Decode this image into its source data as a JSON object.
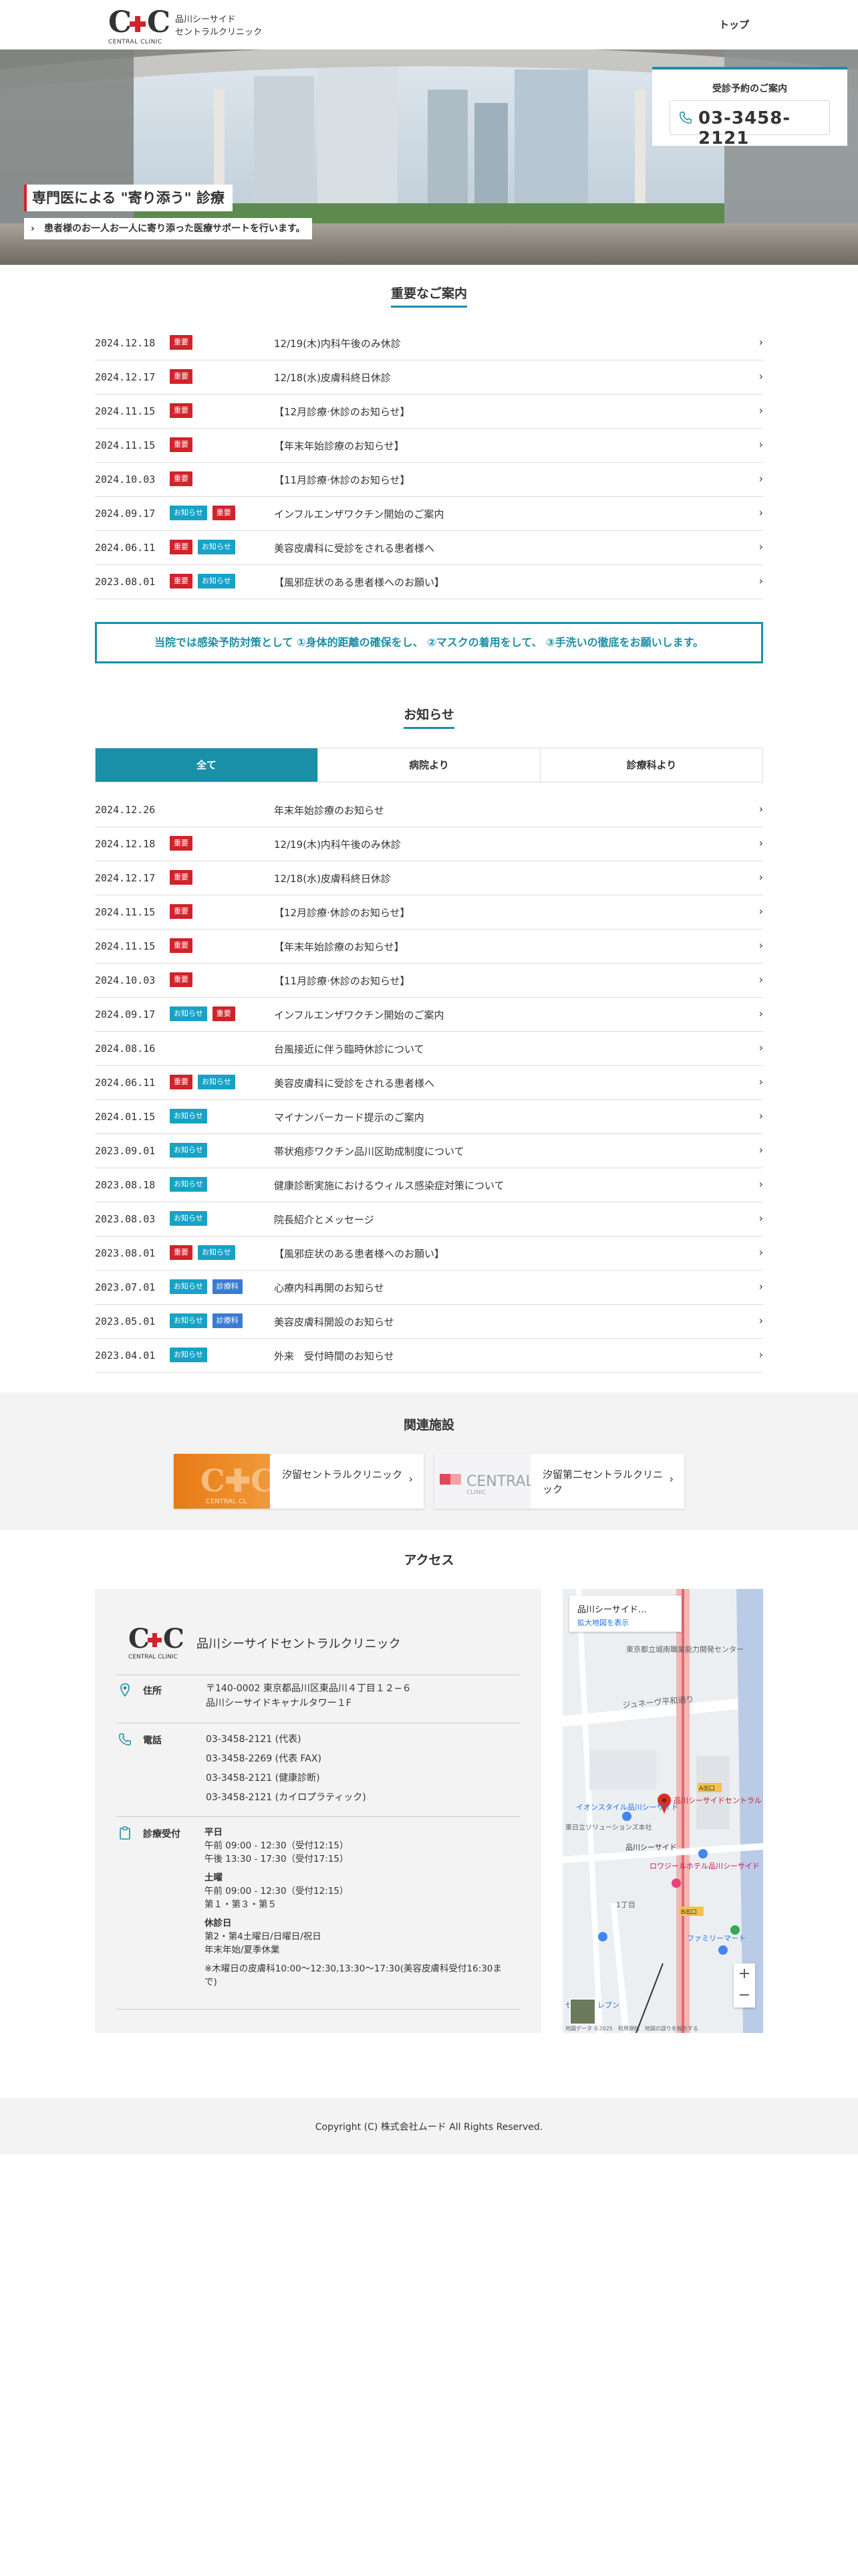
{
  "header": {
    "logo_text": "C✚C",
    "logo_sub": "CENTRAL CLINIC",
    "clinic_name": "品川シーサイド\nセントラルクリニック",
    "nav_top": "トップ"
  },
  "hero": {
    "reserve_title": "受診予約のご案内",
    "phone": "03-3458-2121",
    "title": "専門医による \"寄り添う\" 診療",
    "subtitle": "患者様のお一人お一人に寄り添った医療サポートを行います。"
  },
  "badge_colors": {
    "重要": "#d0232a",
    "お知らせ": "#17a2c6",
    "診療科": "#3a7bd5"
  },
  "important": {
    "heading": "重要なご案内",
    "items": [
      {
        "date": "2024.12.18",
        "badges": [
          "重要"
        ],
        "title": "12/19(木)内科午後のみ休診"
      },
      {
        "date": "2024.12.17",
        "badges": [
          "重要"
        ],
        "title": "12/18(水)皮膚科終日休診"
      },
      {
        "date": "2024.11.15",
        "badges": [
          "重要"
        ],
        "title": "【12月診療·休診のお知らせ】"
      },
      {
        "date": "2024.11.15",
        "badges": [
          "重要"
        ],
        "title": "【年末年始診療のお知らせ】"
      },
      {
        "date": "2024.10.03",
        "badges": [
          "重要"
        ],
        "title": "【11月診療·休診のお知らせ】"
      },
      {
        "date": "2024.09.17",
        "badges": [
          "お知らせ",
          "重要"
        ],
        "title": "インフルエンザワクチン開始のご案内"
      },
      {
        "date": "2024.06.11",
        "badges": [
          "重要",
          "お知らせ"
        ],
        "title": "美容皮膚科に受診をされる患者様へ"
      },
      {
        "date": "2023.08.01",
        "badges": [
          "重要",
          "お知らせ"
        ],
        "title": "【風邪症状のある患者様へのお願い】"
      }
    ]
  },
  "notice": "当院では感染予防対策として ①身体的距離の確保をし、 ②マスクの着用をして、 ③手洗いの徹底をお願いします。",
  "news": {
    "heading": "お知らせ",
    "tabs": [
      "全て",
      "病院より",
      "診療科より"
    ],
    "items": [
      {
        "date": "2024.12.26",
        "badges": [],
        "title": "年末年始診療のお知らせ"
      },
      {
        "date": "2024.12.18",
        "badges": [
          "重要"
        ],
        "title": "12/19(木)内科午後のみ休診"
      },
      {
        "date": "2024.12.17",
        "badges": [
          "重要"
        ],
        "title": "12/18(水)皮膚科終日休診"
      },
      {
        "date": "2024.11.15",
        "badges": [
          "重要"
        ],
        "title": "【12月診療·休診のお知らせ】"
      },
      {
        "date": "2024.11.15",
        "badges": [
          "重要"
        ],
        "title": "【年末年始診療のお知らせ】"
      },
      {
        "date": "2024.10.03",
        "badges": [
          "重要"
        ],
        "title": "【11月診療·休診のお知らせ】"
      },
      {
        "date": "2024.09.17",
        "badges": [
          "お知らせ",
          "重要"
        ],
        "title": "インフルエンザワクチン開始のご案内"
      },
      {
        "date": "2024.08.16",
        "badges": [],
        "title": "台風接近に伴う臨時休診について"
      },
      {
        "date": "2024.06.11",
        "badges": [
          "重要",
          "お知らせ"
        ],
        "title": "美容皮膚科に受診をされる患者様へ"
      },
      {
        "date": "2024.01.15",
        "badges": [
          "お知らせ"
        ],
        "title": "マイナンバーカード提示のご案内"
      },
      {
        "date": "2023.09.01",
        "badges": [
          "お知らせ"
        ],
        "title": "帯状疱疹ワクチン品川区助成制度について"
      },
      {
        "date": "2023.08.18",
        "badges": [
          "お知らせ"
        ],
        "title": "健康診断実施におけるウィルス感染症対策について"
      },
      {
        "date": "2023.08.03",
        "badges": [
          "お知らせ"
        ],
        "title": "院長紹介とメッセージ"
      },
      {
        "date": "2023.08.01",
        "badges": [
          "重要",
          "お知らせ"
        ],
        "title": "【風邪症状のある患者様へのお願い】"
      },
      {
        "date": "2023.07.01",
        "badges": [
          "お知らせ",
          "診療科"
        ],
        "title": "心療内科再開のお知らせ"
      },
      {
        "date": "2023.05.01",
        "badges": [
          "お知らせ",
          "診療科"
        ],
        "title": "美容皮膚科開設のお知らせ"
      },
      {
        "date": "2023.04.01",
        "badges": [
          "お知らせ"
        ],
        "title": "外来　受付時間のお知らせ"
      }
    ]
  },
  "related": {
    "heading": "関連施設",
    "cards": [
      {
        "name": "汐留セントラルクリニック"
      },
      {
        "name": "汐留第二セントラルクリニック"
      }
    ]
  },
  "access": {
    "heading": "アクセス",
    "clinic_name": "品川シーサイドセントラルクリニック",
    "address_label": "住所",
    "address": "〒140-0002 東京都品川区東品川４丁目１２−６\n品川シーサイドキャナルタワー１F",
    "phone_label": "電話",
    "phones": [
      "03-3458-2121 (代表)",
      "03-3458-2269 (代表 FAX)",
      "03-3458-2121 (健康診断)",
      "03-3458-2121 (カイロプラティック)"
    ],
    "hours_label": "診療受付",
    "hours": [
      {
        "head": "平日",
        "lines": [
          "午前 09:00 - 12:30（受付12:15）",
          "午後 13:30 - 17:30（受付17:15）"
        ]
      },
      {
        "head": "土曜",
        "lines": [
          "午前 09:00 - 12:30（受付12:15）",
          "第１・第３・第５"
        ]
      },
      {
        "head": "休診日",
        "lines": [
          "第2・第4土曜日/日曜日/祝日",
          "年末年始/夏季休業"
        ]
      }
    ],
    "hours_note": "※木曜日の皮膚科10:00〜12:30,13:30〜17:30(美容皮膚科受付16:30まで)",
    "map": {
      "place": "品川シーサイド…",
      "enlarge": "拡大地図を表示",
      "labels": [
        "東京都立城南職業能力開発センター",
        "ジュネーヴ平和通り",
        "イオンスタイル品川シーサイド",
        "品川シーサイドセントラルクリニック",
        "品川シーサイド",
        "A出口",
        "B出口",
        "東日立ソリューションズ本社",
        "ロワジールホテル品川シーサイド",
        "ファミリーマート",
        "セブン-イレブン",
        "1丁目"
      ],
      "footer": "地図データ ©2025　利用規約　地図の誤りを報告する",
      "zoom_in": "+",
      "zoom_out": "−"
    }
  },
  "footer": {
    "copyright": "Copyright (C) 株式会社ムード All Rights Reserved."
  }
}
